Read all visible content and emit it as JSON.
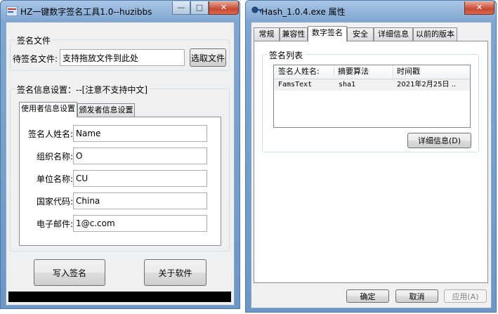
{
  "left_window": {
    "title": "HZ一键数字签名工具1.0--huzibbs",
    "caption": {
      "minimize": "—",
      "maximize": "□",
      "close": "✕"
    },
    "file_group": {
      "title": "签名文件",
      "label": "待签名文件:",
      "input_value": "支持拖放文件到此处",
      "select_button": "选取文件"
    },
    "info_group": {
      "title": "签名信息设置：--[注意不支持中文]",
      "tabs": [
        "使用者信息设置",
        "颁发者信息设置"
      ],
      "fields": [
        {
          "label": "签名人姓名:",
          "value": "Name"
        },
        {
          "label": "组织名称:",
          "value": "O"
        },
        {
          "label": "单位名称:",
          "value": "CU"
        },
        {
          "label": "国家代码:",
          "value": "China"
        },
        {
          "label": "电子邮件:",
          "value": "1@c.com"
        }
      ]
    },
    "buttons": {
      "sign": "写入签名",
      "about": "关于软件"
    }
  },
  "right_window": {
    "title": "Hash_1.0.4.exe 属性",
    "caption": {
      "close": "✕"
    },
    "tabs": [
      "常规",
      "兼容性",
      "数字签名",
      "安全",
      "详细信息",
      "以前的版本"
    ],
    "active_tab": 2,
    "signature_group": {
      "title": "签名列表",
      "columns": [
        "签名人姓名:",
        "摘要算法",
        "时间戳"
      ],
      "rows": [
        {
          "name": "FamsText",
          "algorithm": "sha1",
          "timestamp": "2021年2月25日 .."
        }
      ],
      "details_button": "详细信息(D)"
    },
    "footer": {
      "ok": "确定",
      "cancel": "取消",
      "apply": "应用(A)"
    }
  },
  "colors": {
    "frame": "#7fa6d1",
    "client": "#f0f0f0",
    "selection": "#3399ff",
    "close_button": "#c74a31"
  }
}
